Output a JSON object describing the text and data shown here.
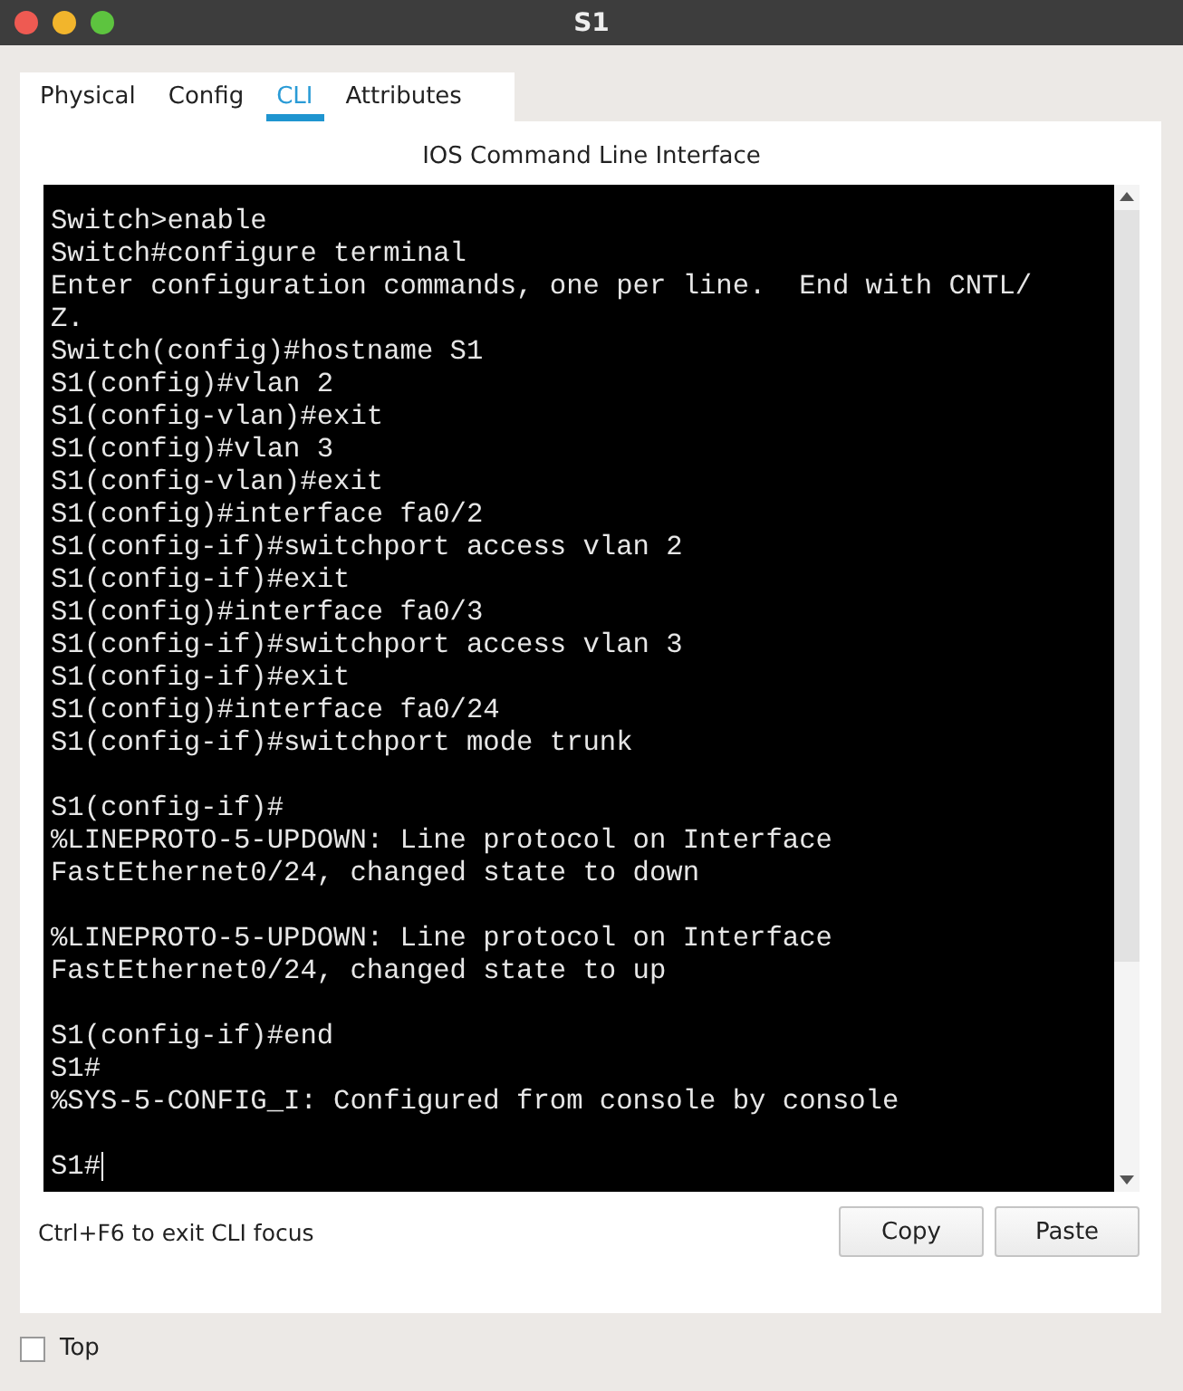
{
  "window": {
    "title": "S1"
  },
  "tabs": [
    {
      "label": "Physical",
      "selected": false
    },
    {
      "label": "Config",
      "selected": false
    },
    {
      "label": "CLI",
      "selected": true
    },
    {
      "label": "Attributes",
      "selected": false
    }
  ],
  "panel_title": "IOS Command Line Interface",
  "terminal": {
    "blocks": [
      [
        "Switch>enable",
        "Switch#configure terminal",
        "Enter configuration commands, one per line.  End with CNTL/",
        "Z.",
        "Switch(config)#hostname S1",
        "S1(config)#vlan 2",
        "S1(config-vlan)#exit",
        "S1(config)#vlan 3",
        "S1(config-vlan)#exit",
        "S1(config)#interface fa0/2",
        "S1(config-if)#switchport access vlan 2",
        "S1(config-if)#exit",
        "S1(config)#interface fa0/3",
        "S1(config-if)#switchport access vlan 3",
        "S1(config-if)#exit",
        "S1(config)#interface fa0/24",
        "S1(config-if)#switchport mode trunk"
      ],
      [
        "S1(config-if)#",
        "%LINEPROTO-5-UPDOWN: Line protocol on Interface",
        "FastEthernet0/24, changed state to down"
      ],
      [
        "%LINEPROTO-5-UPDOWN: Line protocol on Interface",
        "FastEthernet0/24, changed state to up"
      ],
      [
        "S1(config-if)#end",
        "S1#",
        "%SYS-5-CONFIG_I: Configured from console by console"
      ],
      [
        "S1#"
      ]
    ]
  },
  "hint": "Ctrl+F6 to exit CLI focus",
  "buttons": [
    "Copy",
    "Paste"
  ],
  "top_checkbox": {
    "label": "Top",
    "checked": false
  }
}
